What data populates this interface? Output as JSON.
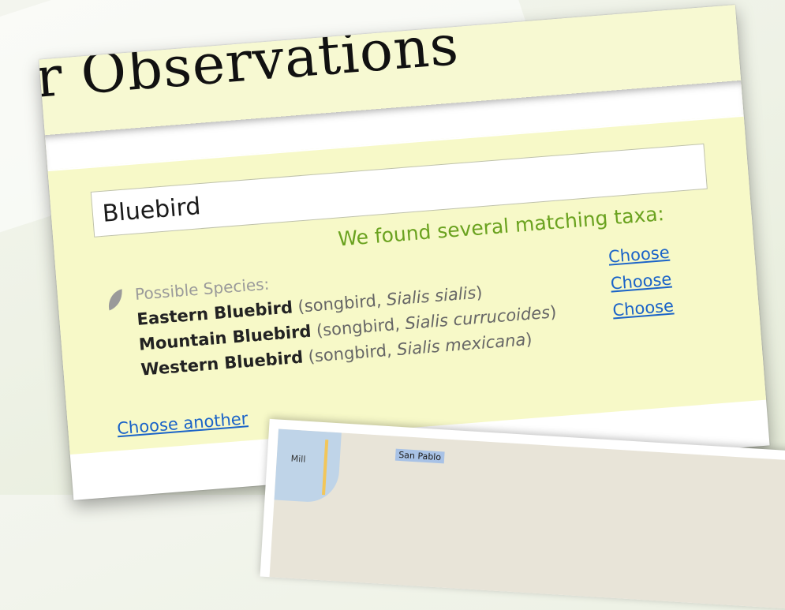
{
  "page": {
    "title": "r Observations"
  },
  "search": {
    "value": "Bluebird"
  },
  "results": {
    "found_message": "We found several matching taxa:",
    "section_label": "Possible Species:",
    "species": [
      {
        "common": "Eastern Bluebird",
        "group": "(songbird, ",
        "scientific": "Sialis sialis",
        "close": ")",
        "action": "Choose"
      },
      {
        "common": "Mountain Bluebird",
        "group": "(songbird, ",
        "scientific": "Sialis currucoides",
        "close": ")",
        "action": "Choose"
      },
      {
        "common": "Western Bluebird",
        "group": "(songbird, ",
        "scientific": "Sialis mexicana",
        "close": ")",
        "action": "Choose"
      }
    ],
    "choose_another": "Choose another"
  },
  "map": {
    "labels": [
      "Mill",
      "San Pablo"
    ]
  },
  "colors": {
    "panel_yellow": "#f7f9c8",
    "found_green": "#6aa21f",
    "link_blue": "#1a63c8"
  },
  "icons": [
    "leaf-icon"
  ]
}
